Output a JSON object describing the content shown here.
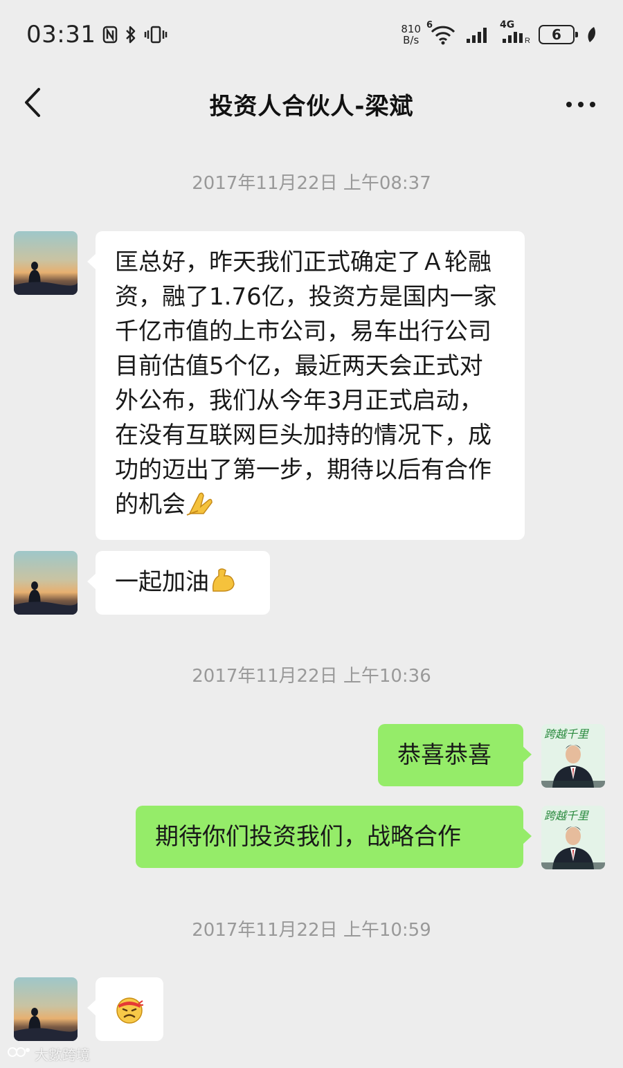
{
  "status_bar": {
    "time": "03:31",
    "net_speed_value": "810",
    "net_speed_unit": "B/s",
    "wifi_label": "6",
    "cellular_label": "4G",
    "battery_level": "6"
  },
  "header": {
    "title": "投资人合伙人-梁斌"
  },
  "messages": [
    {
      "type": "timestamp",
      "text": "2017年11月22日 上午08:37"
    },
    {
      "type": "incoming",
      "text": "匡总好，昨天我们正式确定了Ａ轮融资，融了1.76亿，投资方是国内一家千亿市值的上市公司，易车出行公司目前估值5个亿，最近两天会正式对外公布，我们从今年3月正式启动，在没有互联网巨头加持的情况下，成功的迈出了第一步，期待以后有合作的机会",
      "emoji": "folded-hands"
    },
    {
      "type": "incoming",
      "text": "一起加油",
      "emoji": "flexed-biceps"
    },
    {
      "type": "timestamp",
      "text": "2017年11月22日 上午10:36"
    },
    {
      "type": "outgoing",
      "text": "恭喜恭喜"
    },
    {
      "type": "outgoing",
      "text": "期待你们投资我们，战略合作"
    },
    {
      "type": "timestamp",
      "text": "2017年11月22日 上午10:59"
    },
    {
      "type": "incoming",
      "text": "",
      "emoji": "struggle-face"
    }
  ],
  "watermark": {
    "text": "大數跨境"
  },
  "colors": {
    "background": "#ededed",
    "incoming_bubble": "#ffffff",
    "outgoing_bubble": "#95ec69",
    "timestamp_text": "#999999"
  }
}
